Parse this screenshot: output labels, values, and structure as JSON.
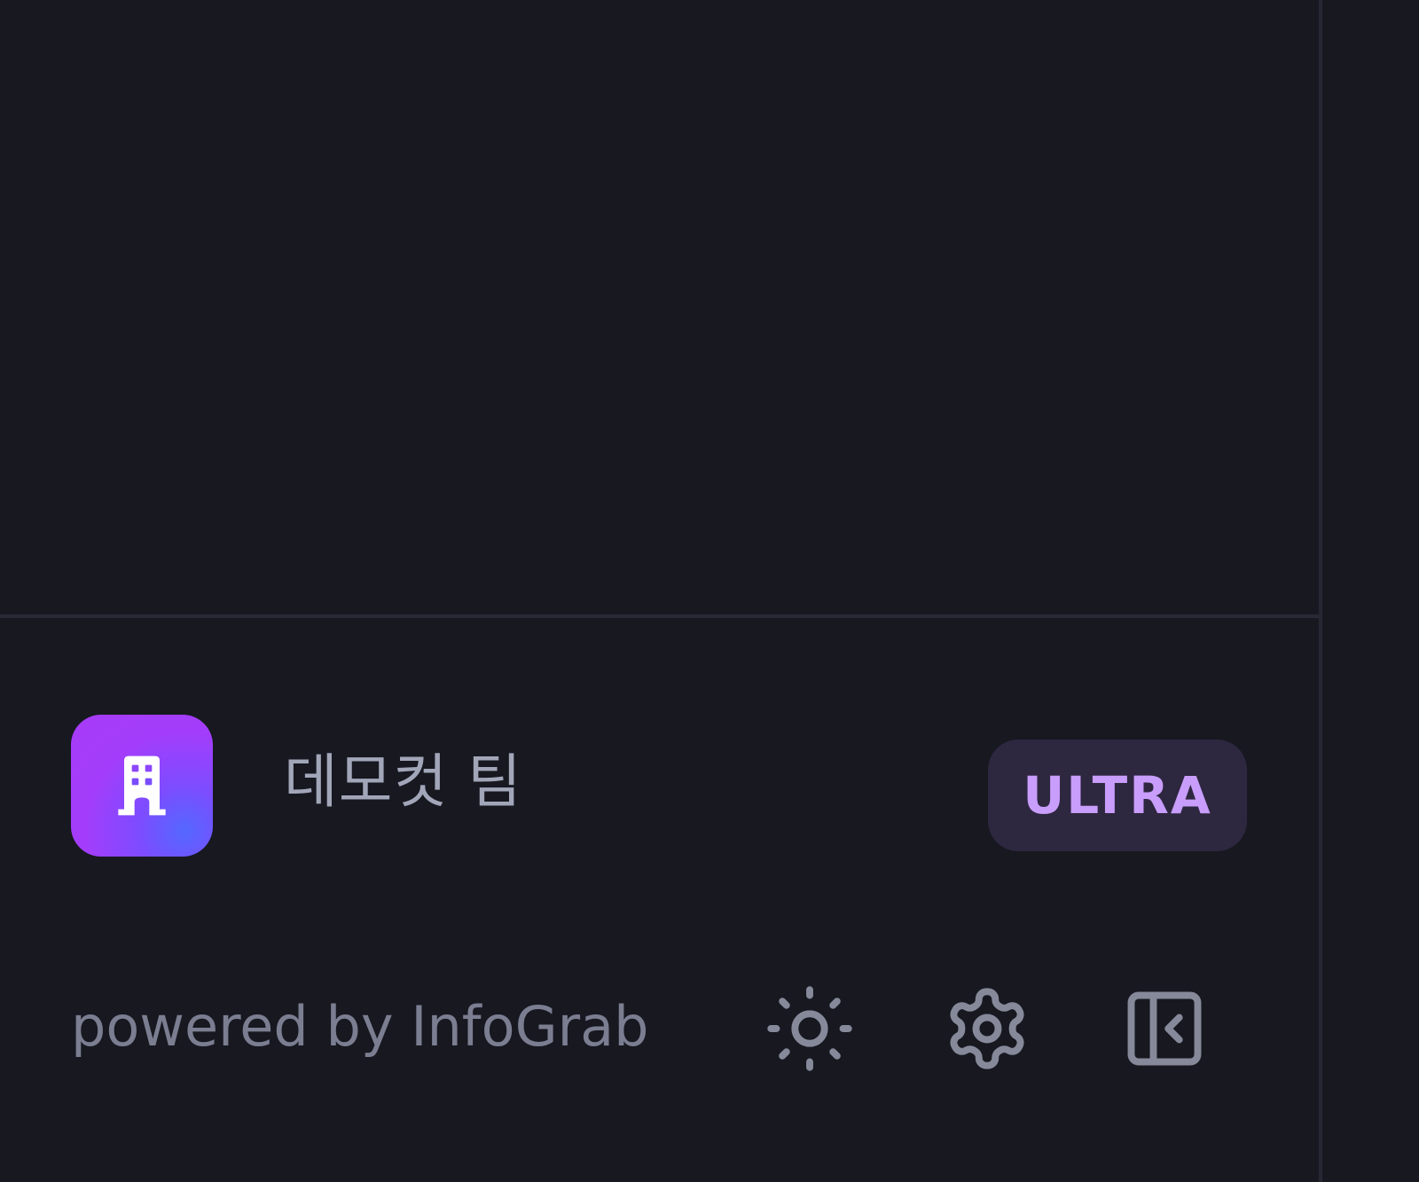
{
  "workspace": {
    "name": "데모컷 팀",
    "plan_badge": "ULTRA",
    "logo_icon": "building-icon",
    "logo_gradient": [
      "#a63cf7",
      "#5468ff"
    ]
  },
  "footer": {
    "powered_by": "powered by InfoGrab",
    "icons": [
      "sun-icon",
      "gear-icon",
      "sidebar-collapse-icon"
    ]
  },
  "colors": {
    "background": "#171820",
    "divider": "#282935",
    "badge_background": "#2d2740",
    "badge_text": "#c89dfb",
    "muted_text": "#7b7e91",
    "name_text": "#a2a6b9"
  }
}
